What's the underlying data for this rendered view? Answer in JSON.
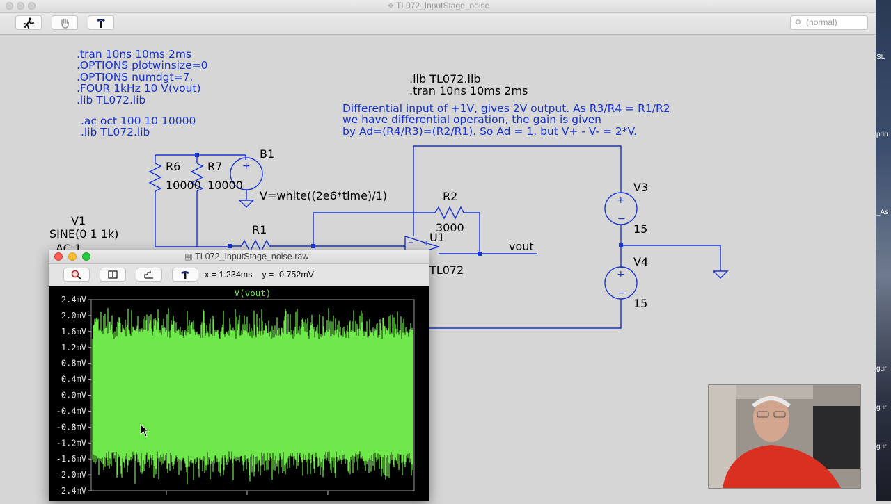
{
  "window": {
    "title": "TL072_InputStage_noise"
  },
  "toolbar": {
    "buttons": [
      {
        "name": "run-button",
        "icon": "running-man-icon"
      },
      {
        "name": "halt-button",
        "icon": "hand-icon"
      },
      {
        "name": "probe-button",
        "icon": "hammer-icon"
      }
    ],
    "search_placeholder": "(normal)"
  },
  "schematic": {
    "directives_left": ".tran 10ns 10ms 2ms\n.OPTIONS plotwinsize=0\n.OPTIONS numdgt=7.\n.FOUR 1kHz 10 V(vout)\n.lib TL072.lib",
    "directives_ac": ".ac oct 100 10 10000\n.lib TL072.lib",
    "directives_right": ".lib TL072.lib\n.tran 10ns 10ms 2ms",
    "comment": "Differential input of +1V, gives 2V output. As R3/R4 = R1/R2\nwe have differential operation, the gain is given\nby Ad=(R4/R3)=(R2/R1). So Ad = 1. but V+ - V- = 2*V.",
    "components": {
      "R6": {
        "name": "R6",
        "value": "10000"
      },
      "R7": {
        "name": "R7",
        "value": "10000"
      },
      "B1": {
        "name": "B1",
        "value": "V=white((2e6*time)/1)"
      },
      "V1": {
        "name": "V1",
        "value": "SINE(0 1 1k)",
        "ac": "AC 1"
      },
      "R1": {
        "name": "R1"
      },
      "R2": {
        "name": "R2",
        "value": "3000"
      },
      "U1": {
        "name": "U1",
        "model": "TL072"
      },
      "V3": {
        "name": "V3",
        "value": "15"
      },
      "V4": {
        "name": "V4",
        "value": "15"
      }
    },
    "net_label": "vout"
  },
  "waveform_window": {
    "title": "TL072_InputStage_noise.raw",
    "buttons": [
      {
        "name": "zoom-button",
        "icon": "zoom-icon"
      },
      {
        "name": "autorange-button",
        "icon": "autorange-icon"
      },
      {
        "name": "measure-button",
        "icon": "measure-icon"
      },
      {
        "name": "probe-button",
        "icon": "hammer-icon"
      }
    ],
    "cursor_readout": "x = 1.234ms    y = -0.752mV"
  },
  "chart_data": {
    "type": "line",
    "title": "",
    "series": [
      {
        "name": "V(vout)",
        "color": "#6ee84a",
        "values_note_amplitude_mV": [
          -2.0,
          2.0
        ]
      }
    ],
    "xlabel": "",
    "ylabel": "",
    "y_tick_labels": [
      "2.4mV",
      "2.0mV",
      "1.6mV",
      "1.2mV",
      "0.8mV",
      "0.4mV",
      "0.0mV",
      "-0.4mV",
      "-0.8mV",
      "-1.2mV",
      "-1.6mV",
      "-2.0mV",
      "-2.4mV"
    ],
    "ylim": [
      -2.4,
      2.4
    ],
    "grid": false,
    "signal": "white noise band between approx -2.0mV and 2.0mV"
  },
  "colors": {
    "wire": "#1733d6",
    "trace": "#6ee84a",
    "plot_bg": "#000000",
    "directive": "#1733d6"
  },
  "right_strip_labels": [
    "SL",
    "prin",
    "_As",
    "gur",
    "gur",
    "gur"
  ]
}
